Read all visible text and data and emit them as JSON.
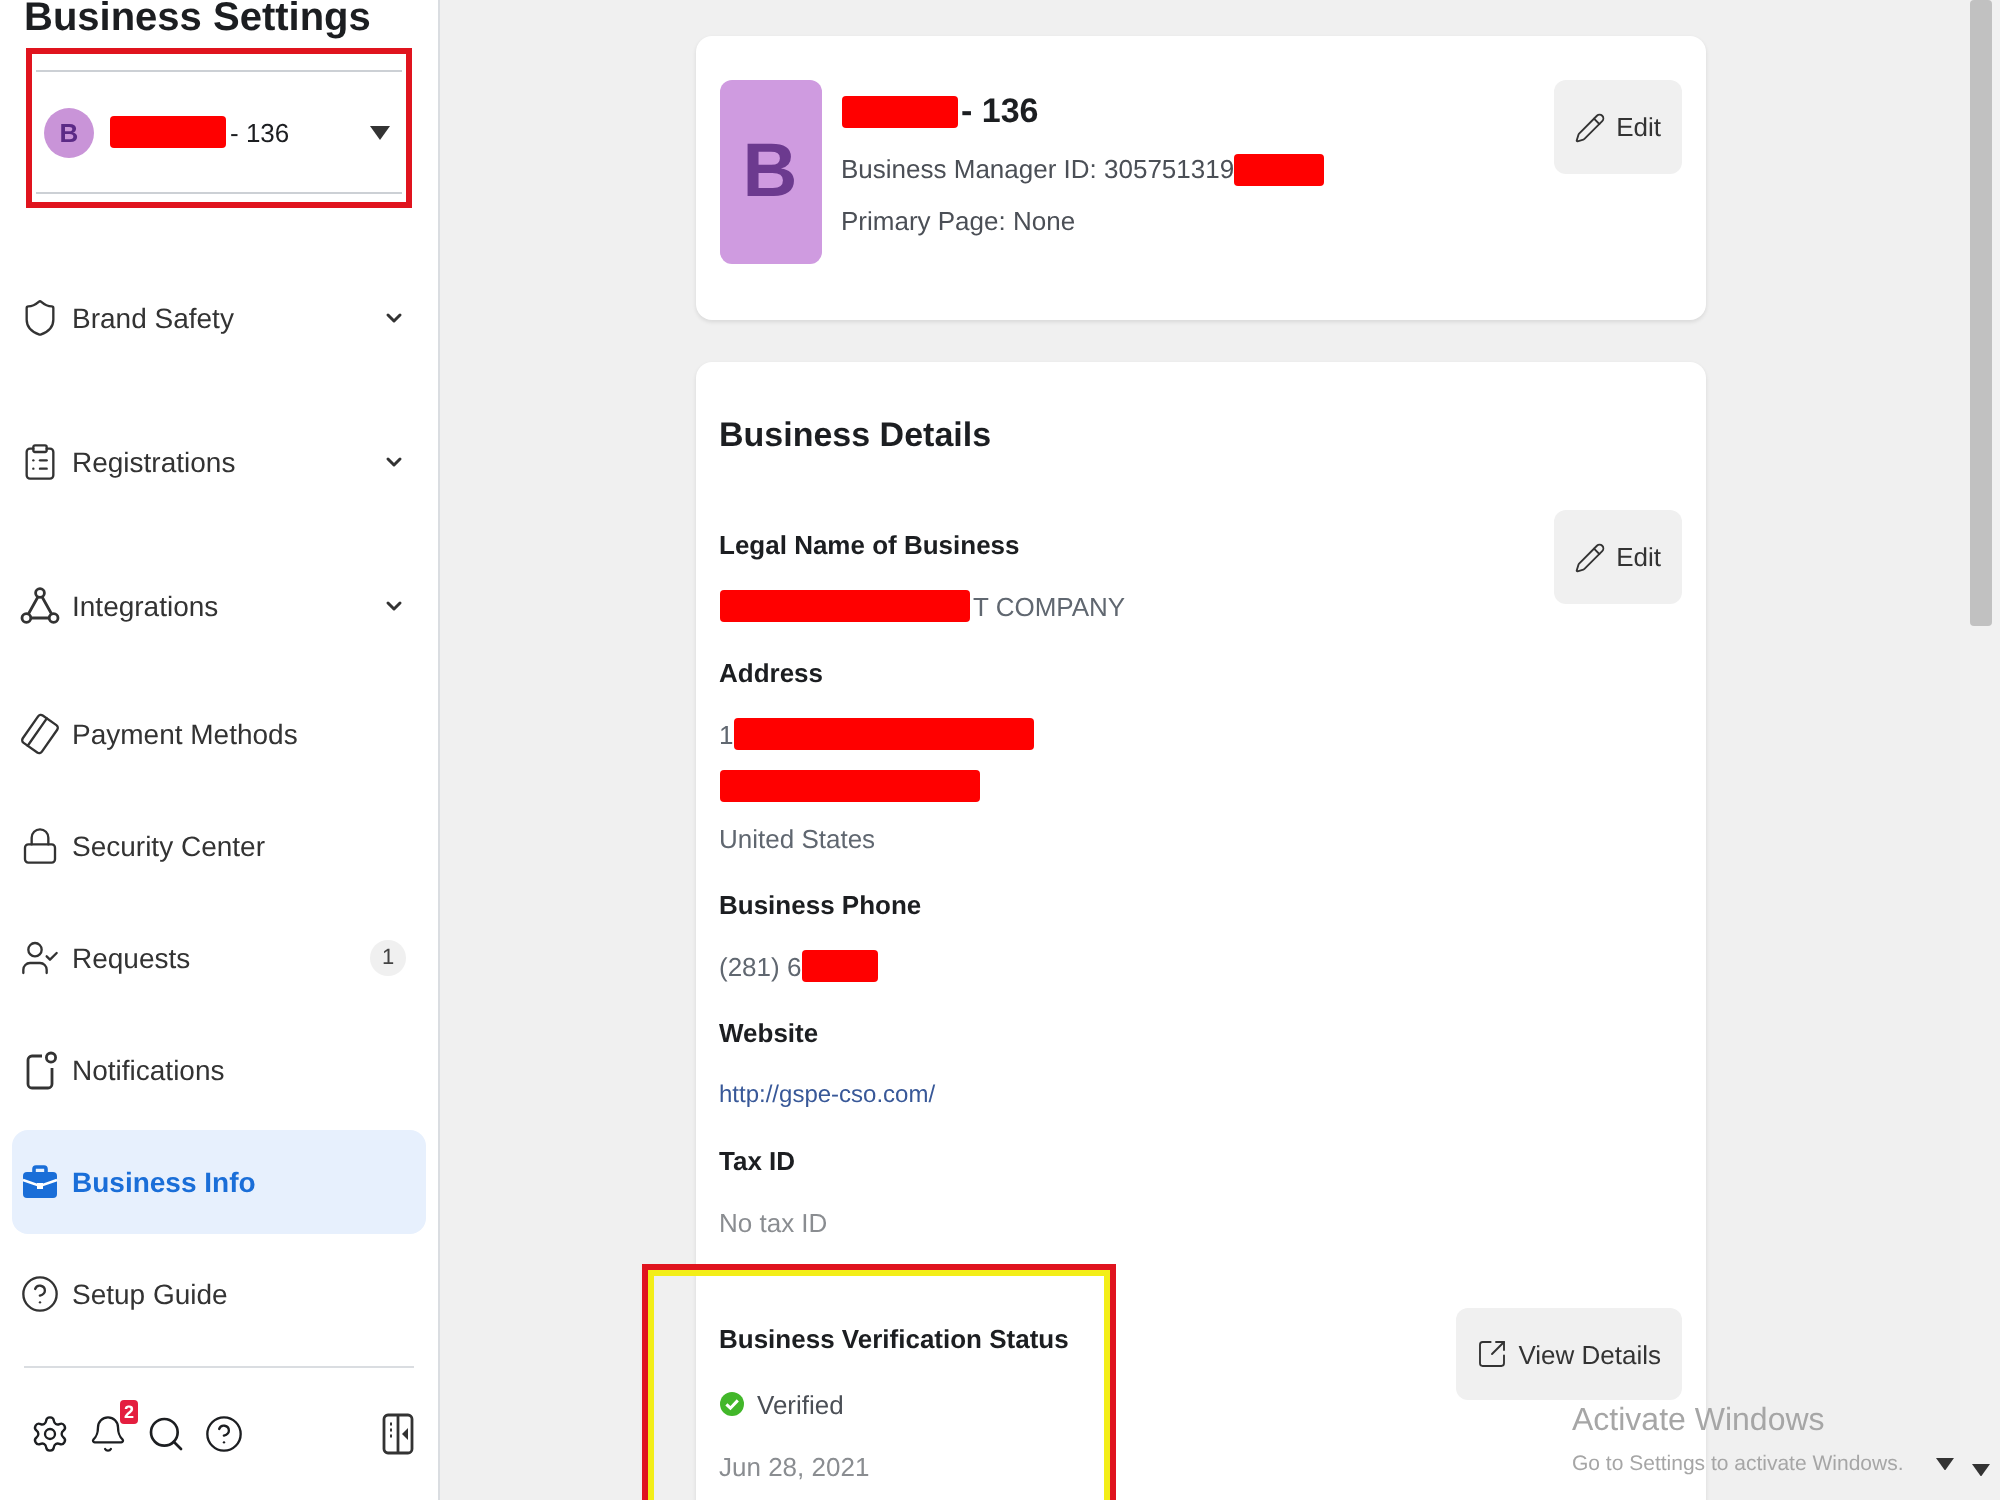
{
  "sidebar": {
    "title": "Business Settings",
    "account": {
      "avatar_letter": "B",
      "name_parts": [
        {
          "kind": "redaction"
        },
        {
          "kind": "text",
          "text": "- 136"
        }
      ],
      "highlighted": true
    },
    "items": [
      {
        "label": "Brand Safety",
        "kind": "group",
        "expanded": false,
        "selected": false
      },
      {
        "label": "Registrations",
        "kind": "group",
        "expanded": false,
        "selected": false
      },
      {
        "label": "Integrations",
        "kind": "group",
        "expanded": false,
        "selected": false
      },
      {
        "label": "Payment Methods",
        "kind": "page",
        "selected": false
      },
      {
        "label": "Security Center",
        "kind": "page",
        "selected": false
      },
      {
        "label": "Requests",
        "kind": "page",
        "selected": false,
        "count": "1"
      },
      {
        "label": "Notifications",
        "kind": "page",
        "selected": false
      },
      {
        "label": "Business Info",
        "kind": "page",
        "selected": true
      },
      {
        "label": "Setup Guide",
        "kind": "page",
        "selected": false
      }
    ],
    "notification_count": "2"
  },
  "profile": {
    "avatar_letter": "B",
    "name_parts": [
      {
        "kind": "redaction"
      },
      {
        "kind": "text",
        "text": "- 136"
      }
    ],
    "id_parts": [
      {
        "kind": "text",
        "text": "Business Manager ID: 305751319"
      },
      {
        "kind": "redaction"
      }
    ],
    "primary_page": "Primary Page: None",
    "edit_label": "Edit"
  },
  "details": {
    "title": "Business Details",
    "edit_label": "Edit",
    "fields": [
      {
        "label": "Legal Name of Business",
        "lines": [
          [
            {
              "kind": "redaction"
            },
            {
              "kind": "text",
              "text": "T COMPANY"
            }
          ]
        ]
      },
      {
        "label": "Address",
        "lines": [
          [
            {
              "kind": "text",
              "text": "1"
            },
            {
              "kind": "redaction"
            }
          ],
          [
            {
              "kind": "redaction"
            }
          ],
          [
            {
              "kind": "text",
              "text": "United States"
            }
          ]
        ]
      },
      {
        "label": "Business Phone",
        "lines": [
          [
            {
              "kind": "text",
              "text": "(281) 6"
            },
            {
              "kind": "redaction"
            }
          ]
        ]
      },
      {
        "label": "Website",
        "lines": [
          [
            {
              "kind": "link",
              "text": "http://gspe-cso.com/"
            }
          ]
        ]
      },
      {
        "label": "Tax ID",
        "lines": [
          [
            {
              "kind": "muted",
              "text": "No tax ID"
            }
          ]
        ]
      }
    ],
    "verification": {
      "label": "Business Verification Status",
      "status": "Verified",
      "verified": true,
      "date": "Jun 28, 2021",
      "highlighted": true,
      "button_label": "View Details"
    }
  },
  "os_notice": {
    "title": "Activate Windows",
    "message": "Go to Settings to activate Windows."
  }
}
